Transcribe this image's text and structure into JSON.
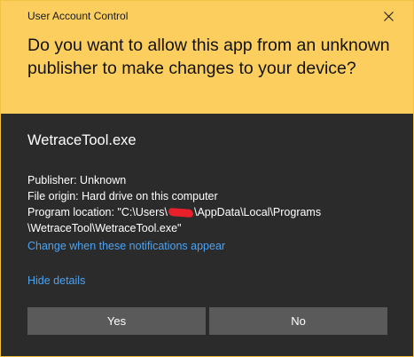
{
  "dialog": {
    "title": "User Account Control",
    "question": "Do you want to allow this app from an unknown publisher to make changes to your device?",
    "app_name": "WetraceTool.exe",
    "publisher": "Publisher: Unknown",
    "file_origin": "File origin: Hard drive on this computer",
    "program_location_prefix": "Program location: \"C:\\Users\\",
    "program_location_suffix": "\\AppData\\Local\\Programs",
    "program_location_line2": "\\WetraceTool\\WetraceTool.exe\"",
    "change_notifications_link": "Change when these notifications appear",
    "hide_details_link": "Hide details",
    "yes_label": "Yes",
    "no_label": "No"
  },
  "colors": {
    "header_bg": "#fcce5e",
    "body_bg": "#2b2b2b",
    "link": "#4ca3f2",
    "button_bg": "#5a5a5a",
    "redaction": "#e8202a"
  },
  "icons": {
    "close": "close-icon"
  }
}
